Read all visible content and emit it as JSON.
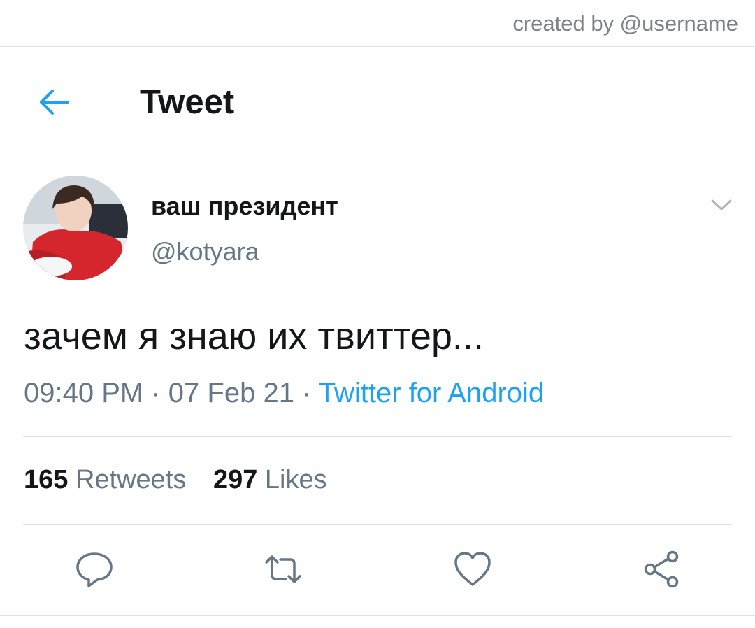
{
  "watermark": "created by @username",
  "header": {
    "title": "Tweet",
    "back_icon": "arrow-left-icon"
  },
  "author": {
    "display_name": "ваш президент",
    "handle": "@kotyara",
    "avatar": "user-avatar-photo"
  },
  "tweet": {
    "text": "зачем я знаю их твиттер...",
    "time": "09:40 PM",
    "date": "07 Feb 21",
    "separator": "·",
    "source": "Twitter for Android"
  },
  "stats": {
    "retweets_count": "165",
    "retweets_label": "Retweets",
    "likes_count": "297",
    "likes_label": "Likes"
  },
  "actions": [
    "reply-icon",
    "retweet-icon",
    "like-icon",
    "share-icon"
  ],
  "colors": {
    "accent": "#1da1f2",
    "text_primary": "#14171a",
    "text_secondary": "#657786",
    "divider": "#dfe3e6"
  }
}
